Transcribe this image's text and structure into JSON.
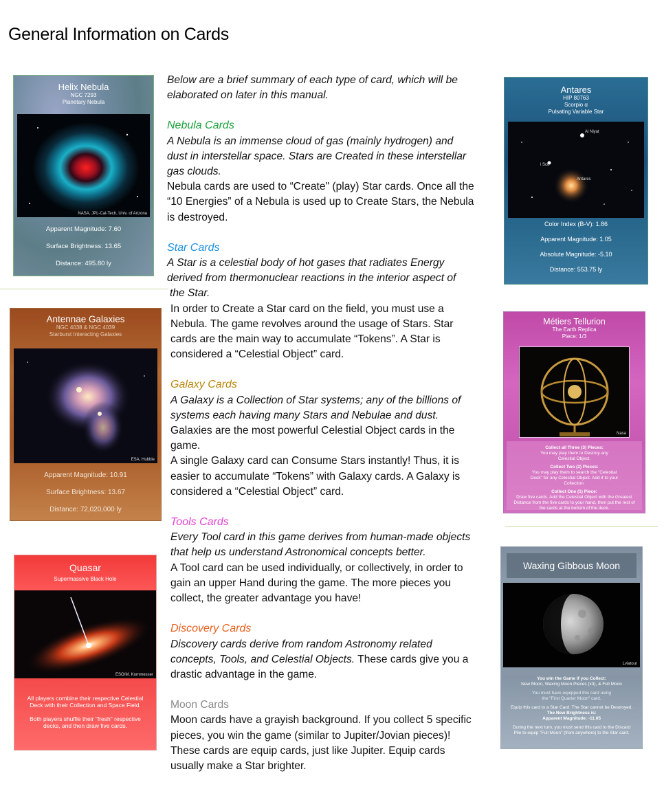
{
  "page": {
    "title": "General Information on Cards"
  },
  "intro": [
    "Below are a brief summary of each type of card, which will be",
    "elaborated on later in this manual."
  ],
  "sections": {
    "nebula": {
      "heading": "Nebula Cards",
      "color": "#1aa23c",
      "desc": [
        "A Nebula is an immense cloud of gas (mainly hydrogen) and",
        "dust in interstellar space. Stars are Created in these interstellar",
        "gas clouds."
      ],
      "body": [
        "Nebula cards are used to “Create\" (play) Star cards. Once all the",
        "“10 Energies” of a Nebula is used up to Create Stars, the Nebula",
        "is destroyed."
      ]
    },
    "star": {
      "heading": "Star Cards",
      "color": "#1a8fe0",
      "desc": [
        "A Star is a celestial body of hot gases that radiates Energy",
        "derived from thermonuclear reactions in the interior aspect of",
        " the Star."
      ],
      "body": [
        "In order to Create a Star card on the field, you must use a",
        "Nebula. The game revolves around the usage of Stars. Star",
        "cards are the main way to accumulate “Tokens”. A Star is",
        "considered a “Celestial Object” card."
      ]
    },
    "galaxy": {
      "heading": "Galaxy Cards",
      "color": "#b8860b",
      "desc": [
        "A Galaxy is a Collection of Star systems; any of the billions of",
        "systems each having many Stars and Nebulae and dust."
      ],
      "body": [
        "Galaxies are the most powerful Celestial Object cards in the",
        "game.",
        "A single Galaxy card can Consume Stars instantly! Thus, it is",
        "easier to accumulate “Tokens” with Galaxy cards. A Galaxy is",
        "considered a “Celestial Object” card."
      ]
    },
    "tools": {
      "heading": "Tools Cards",
      "color": "#e040d0",
      "desc": [
        "Every Tool card in this game derives from human-made objects",
        "that help us understand Astronomical concepts better."
      ],
      "body": [
        "A Tool card can be used individually, or collectively, in order to",
        "gain an upper Hand during the game. The more pieces you",
        "collect, the greater advantage you have!"
      ]
    },
    "discovery": {
      "heading": "Discovery Cards",
      "color": "#e8601c",
      "desc1": "Discovery cards derive from random Astronomy related",
      "desc2": "concepts, Tools, and Celestial Objects.",
      "desc2_rest": " These cards give you a",
      "desc3": "drastic advantage in the game."
    },
    "moon": {
      "heading": "Moon Cards",
      "color": "#8a8a8a",
      "body": [
        "Moon cards have a grayish background. If you collect 5 specific",
        "pieces, you win the game (similar to Jupiter/Jovian pieces)!",
        "These cards are equip cards, just like Jupiter. Equip cards",
        "usually make a Star brighter."
      ]
    }
  },
  "cards": {
    "helix": {
      "title": "Helix Nebula",
      "sub1": "NGC 7293",
      "sub2": "Planetary Nebula",
      "credit": "NASA, JPL-Cal-Tech, Univ. of Arizona",
      "stats": [
        "Apparent Magnitude: 7.60",
        "Surface Brightness: 13.65",
        "Distance: 495.80 ly"
      ]
    },
    "antares": {
      "title": "Antares",
      "sub1": "HIP 80763",
      "sub2": "Scorpio α",
      "sub3": "Pulsating Variable Star",
      "labels": [
        "Al Niyat",
        "i Sco",
        "Antares"
      ],
      "stats": [
        "Color Index (B-V): 1.86",
        "Apparent Magnitude: 1.05",
        "Absolute Magnitude: -5.10",
        "Distance: 553.75 ly"
      ]
    },
    "antennae": {
      "title": "Antennae Galaxies",
      "sub1": "NGC 4038 & NGC 4039",
      "sub2": "Starburst Interacting Galaxies",
      "credit": "ESA, Hubble",
      "stats": [
        "Apparent Magnitude: 10.91",
        "Surface Brightness: 13.67",
        "Distance: 72,020,000 ly"
      ]
    },
    "metiers": {
      "title": "Métiers Tellurion",
      "sub1": "The Earth Replica",
      "sub2": "Piece: 1/3",
      "credit": "Nasa",
      "h1": "Collect all Three (3) Pieces:",
      "t1": "You may play them to Destroy any Celestial Object.",
      "h2": "Collect Two (2) Pieces:",
      "t2": "You may play them to search the \"Celestial Deck\" for any Celestial Object. Add it to your Collection.",
      "h3": "Collect  One (1) Piece:",
      "t3": "Draw five cards. Add the Celestial Object with the Greatest Distance from the five cards to your hand, then put the rest of the cards at the bottom of the deck."
    },
    "quasar": {
      "title": "Quasar",
      "sub1": "Supermassive Black Hole",
      "credit": "ESO/M. Kornmesser",
      "t1": "All players combine their respective Celestial Deck with their Collection and Space Field.",
      "t2": "Both players shuffle their \"fresh\" respective decks, and then draw five cards."
    },
    "moon": {
      "title": "Waxing Gibbous Moon",
      "credit": "Lviatour",
      "h1": "You win the Game if you Collect:",
      "t1": "New Moon, Waxing Moon Pieces (x3), & Full Moon",
      "t2a": "You must have equipped this card using",
      "t2b": "the \"First Quarter Moon\" card.",
      "t3": "Equip this card to a Star Card. The Star cannot be Destroyed.",
      "h4": "The New Brightness is:",
      "h5": "Apparent Magnitude: -11.05",
      "t4": "During the next turn, you must send this card to the Discard Pile to equip \"Full Moon\" (from anywhere) to the Star card."
    }
  }
}
